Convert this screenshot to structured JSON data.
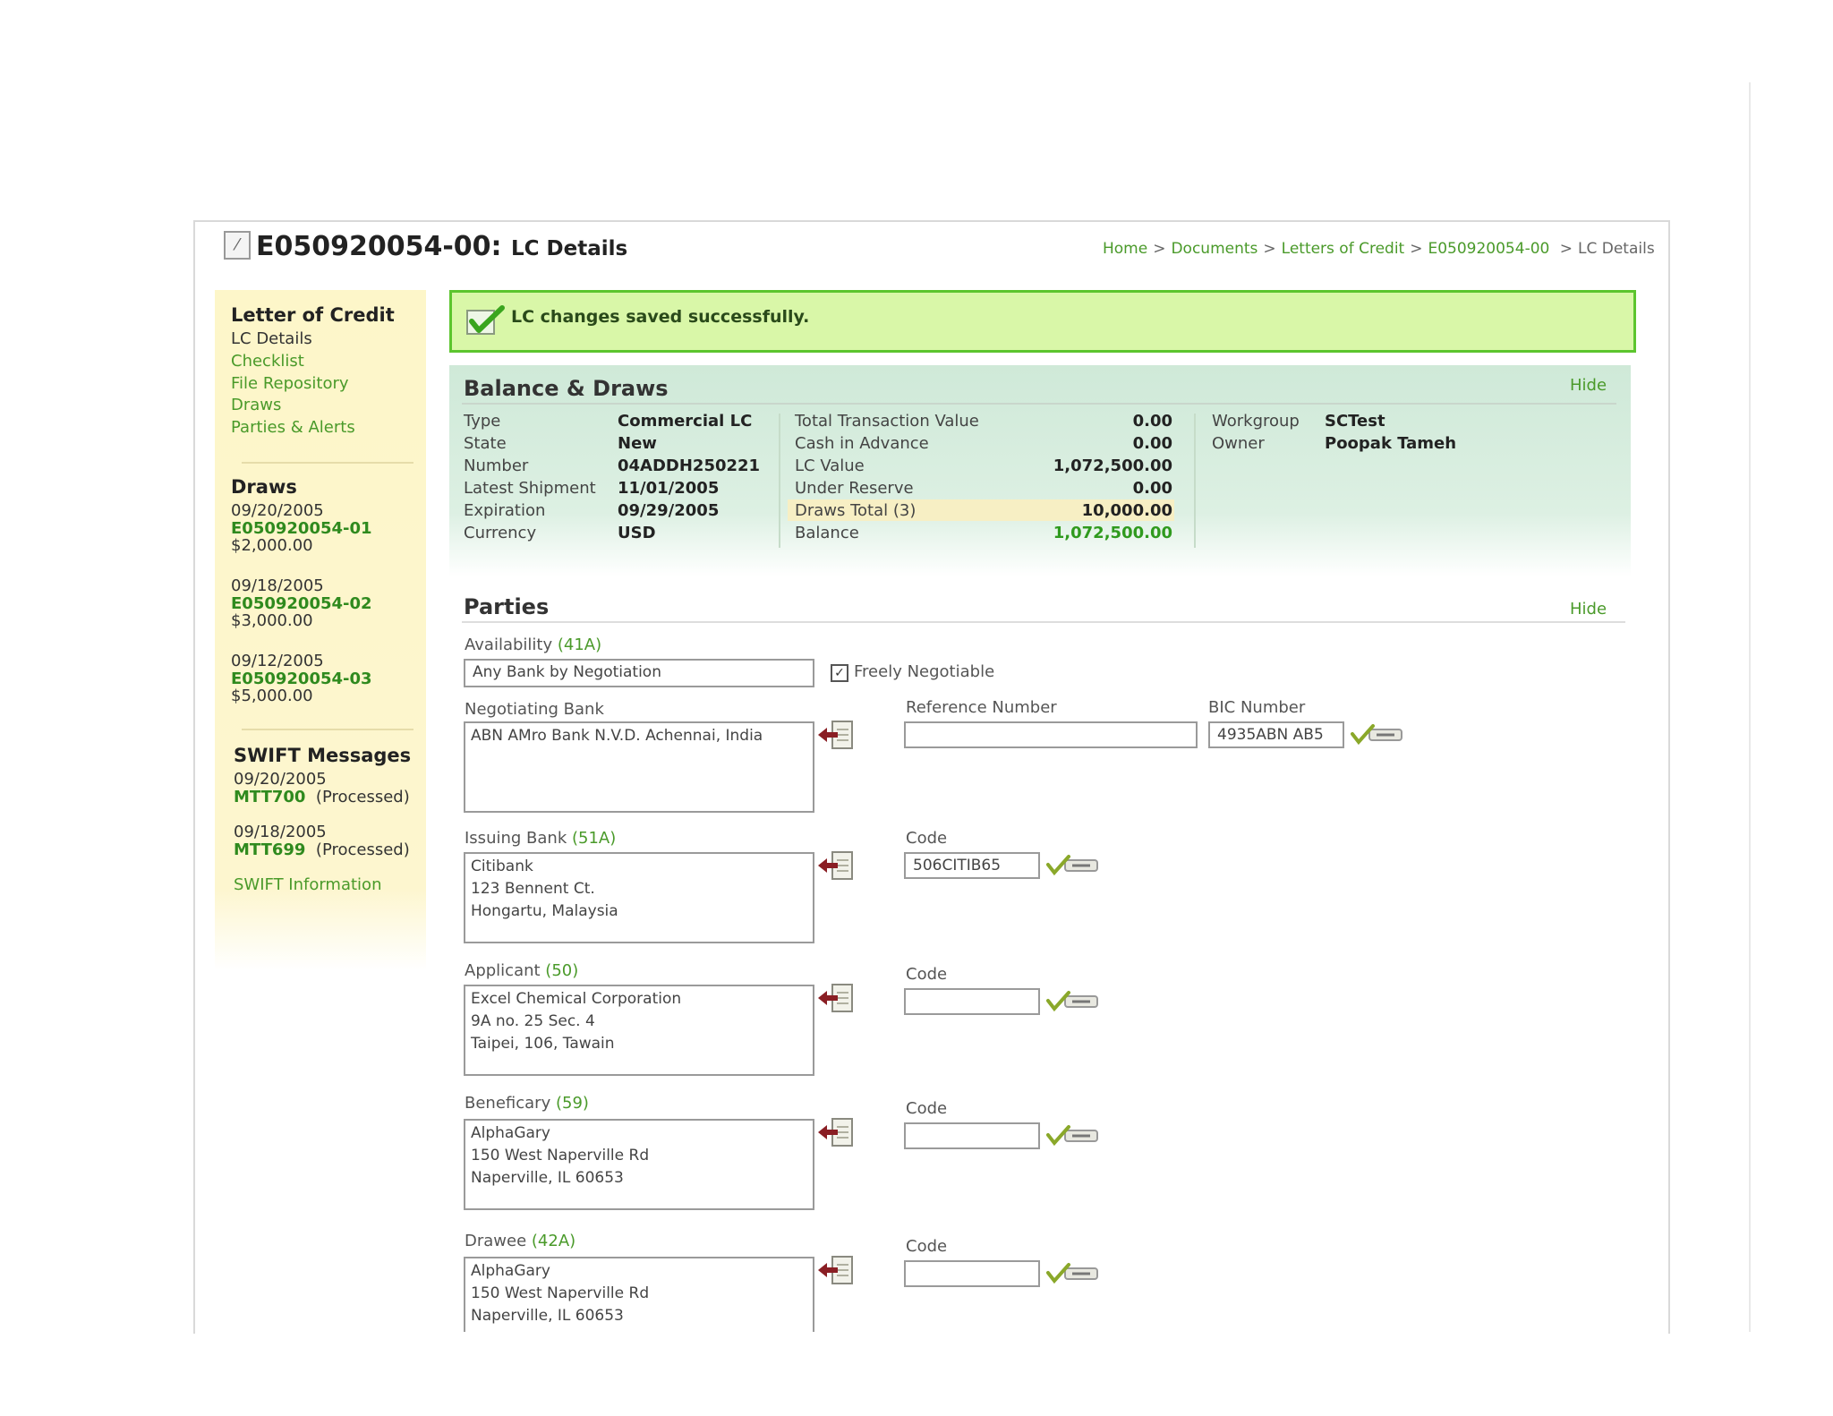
{
  "header": {
    "doc_id": "E050920054-00:",
    "subtitle": "LC Details",
    "breadcrumb": [
      "Home",
      "Documents",
      "Letters of Credit",
      "E050920054-00",
      "LC Details"
    ]
  },
  "sidebar": {
    "lc_heading": "Letter of Credit",
    "lc_current": "LC Details",
    "lc_links": [
      "Checklist",
      "File Repository",
      "Draws",
      "Parties & Alerts"
    ],
    "draws_heading": "Draws",
    "draws": [
      {
        "date": "09/20/2005",
        "id": "E050920054-01",
        "amount": "$2,000.00"
      },
      {
        "date": "09/18/2005",
        "id": "E050920054-02",
        "amount": "$3,000.00"
      },
      {
        "date": "09/12/2005",
        "id": "E050920054-03",
        "amount": "$5,000.00"
      }
    ],
    "swift_heading": "SWIFT Messages",
    "swift": [
      {
        "date": "09/20/2005",
        "id": "MTT700",
        "status": "(Processed)"
      },
      {
        "date": "09/18/2005",
        "id": "MTT699",
        "status": "(Processed)"
      }
    ],
    "swift_info": "SWIFT Information"
  },
  "alert": {
    "message": "LC changes saved successfully."
  },
  "balance": {
    "title": "Balance & Draws",
    "hide": "Hide",
    "col1": [
      {
        "label": "Type",
        "value": "Commercial LC"
      },
      {
        "label": "State",
        "value": "New"
      },
      {
        "label": "Number",
        "value": "04ADDH250221"
      },
      {
        "label": "Latest Shipment",
        "value": "11/01/2005"
      },
      {
        "label": "Expiration",
        "value": "09/29/2005"
      },
      {
        "label": "Currency",
        "value": "USD"
      }
    ],
    "col2": [
      {
        "label": "Total Transaction Value",
        "value": "0.00"
      },
      {
        "label": "Cash in Advance",
        "value": "0.00"
      },
      {
        "label": "LC Value",
        "value": "1,072,500.00"
      },
      {
        "label": "Under Reserve",
        "value": "0.00"
      },
      {
        "label": "Draws Total (3)",
        "value": "10,000.00"
      },
      {
        "label": "Balance",
        "value": "1,072,500.00"
      }
    ],
    "col3": [
      {
        "label": "Workgroup",
        "value": "SCTest"
      },
      {
        "label": "Owner",
        "value": "Poopak Tameh"
      }
    ],
    "balance_color": "#2f9a1e",
    "draws_highlight": "#f7efc4"
  },
  "parties": {
    "title": "Parties",
    "hide": "Hide",
    "availability": {
      "label": "Availability",
      "code": "(41A)",
      "value": "Any Bank by Negotiation",
      "freely_label": "Freely Negotiable",
      "freely_checked": true
    },
    "negotiating": {
      "label": "Negotiating Bank",
      "text": "ABN AMro Bank N.V.D. Achennai, India",
      "ref_label": "Reference Number",
      "ref_value": "",
      "bic_label": "BIC Number",
      "bic_value": "4935ABN AB5"
    },
    "issuing": {
      "label": "Issuing Bank",
      "code": "(51A)",
      "text": "Citibank\n123 Bennent Ct.\nHongartu, Malaysia",
      "code_label": "Code",
      "code_value": "506CITIB65"
    },
    "applicant": {
      "label": "Applicant",
      "code": "(50)",
      "text": "Excel Chemical Corporation\n9A no. 25 Sec. 4\nTaipei, 106, Tawain",
      "code_label": "Code",
      "code_value": ""
    },
    "beneficiary": {
      "label": "Beneficary",
      "code": "(59)",
      "text": "AlphaGary\n150 West Naperville Rd\nNaperville, IL 60653",
      "code_label": "Code",
      "code_value": ""
    },
    "drawee": {
      "label": "Drawee",
      "code": "(42A)",
      "text": "AlphaGary\n150 West Naperville Rd\nNaperville, IL 60653",
      "code_label": "Code",
      "code_value": ""
    }
  },
  "icons": [
    "lc-document-icon",
    "success-check-icon",
    "address-book-icon",
    "verify-code-icon",
    "checkbox-icon"
  ],
  "colors": {
    "link": "#4a9a2a",
    "success_bg": "#d9f7a8",
    "success_border": "#5cc52e",
    "sidebar_bg": "#fdf6c9",
    "balance_bg": "#cfe9d8"
  }
}
